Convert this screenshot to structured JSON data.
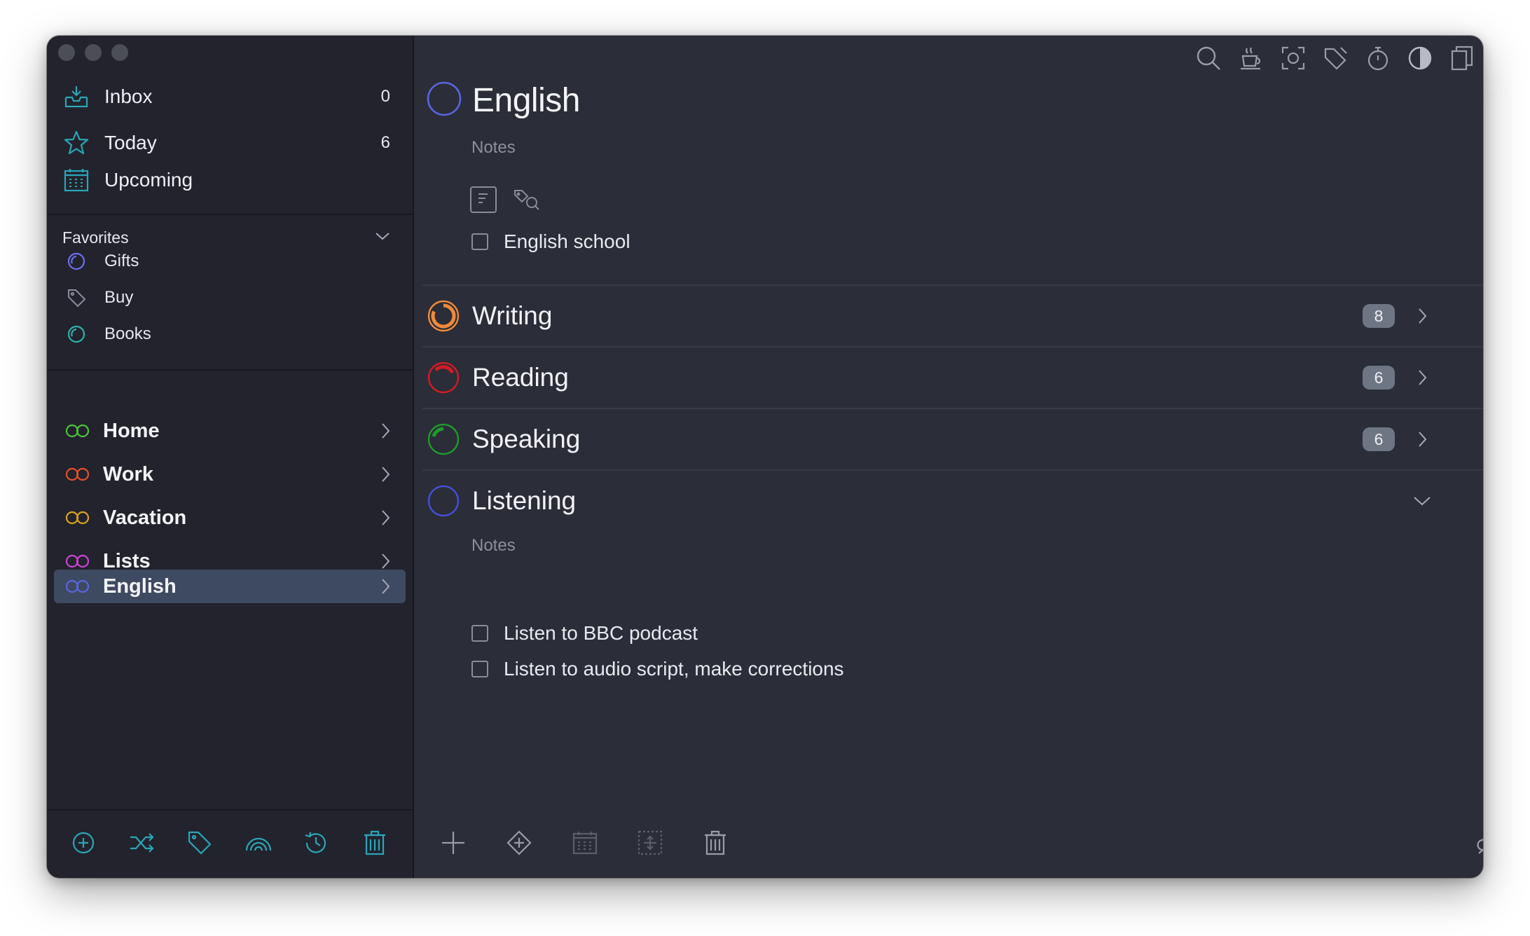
{
  "colors": {
    "accent": "#2aa6b8",
    "home": "#4cc43c",
    "work": "#e4502c",
    "vacation": "#d9a41c",
    "lists": "#cc43d8",
    "english": "#5866e0",
    "writing": "#f08a3a",
    "reading": "#d11c24",
    "speaking": "#1e9a2c"
  },
  "sidebar": {
    "nav": [
      {
        "label": "Inbox",
        "count": "0",
        "icon": "inbox-icon"
      },
      {
        "label": "Today",
        "count": "6",
        "icon": "star-icon"
      },
      {
        "label": "Upcoming",
        "count": "",
        "icon": "calendar-icon"
      }
    ],
    "favorites": {
      "label": "Favorites",
      "items": [
        {
          "label": "Gifts",
          "icon": "project-icon"
        },
        {
          "label": "Buy",
          "icon": "tag-icon"
        },
        {
          "label": "Books",
          "icon": "project-icon"
        }
      ]
    },
    "areas": [
      {
        "label": "Home"
      },
      {
        "label": "Work"
      },
      {
        "label": "Vacation"
      },
      {
        "label": "Lists"
      },
      {
        "label": "English",
        "active": true
      }
    ],
    "bottom_icons": [
      "add-circle-icon",
      "shuffle-icon",
      "tag-icon",
      "rainbow-icon",
      "history-icon",
      "trash-icon"
    ]
  },
  "toolbar_icons": [
    "search-icon",
    "coffee-icon",
    "focus-icon",
    "tag-edit-icon",
    "stopwatch-icon",
    "contrast-icon",
    "copy-icon"
  ],
  "project": {
    "title": "English",
    "notes_placeholder": "Notes",
    "todos": [
      {
        "label": "English school"
      }
    ]
  },
  "headings": [
    {
      "label": "Writing",
      "badge": "8",
      "progress": 0.9
    },
    {
      "label": "Reading",
      "badge": "6",
      "progress": 0.3
    },
    {
      "label": "Speaking",
      "badge": "6",
      "progress": 0.2
    },
    {
      "label": "Listening",
      "badge": "",
      "progress": 0,
      "expanded": true
    }
  ],
  "listening": {
    "notes_placeholder": "Notes",
    "todos": [
      {
        "label": "Listen to BBC podcast"
      },
      {
        "label": "Listen to audio script, make corrections"
      }
    ]
  },
  "bottom_toolbar_icons": [
    "add-icon",
    "tag-diamond-icon",
    "calendar-icon",
    "move-icon",
    "trash-icon",
    "cloud-off-icon"
  ]
}
